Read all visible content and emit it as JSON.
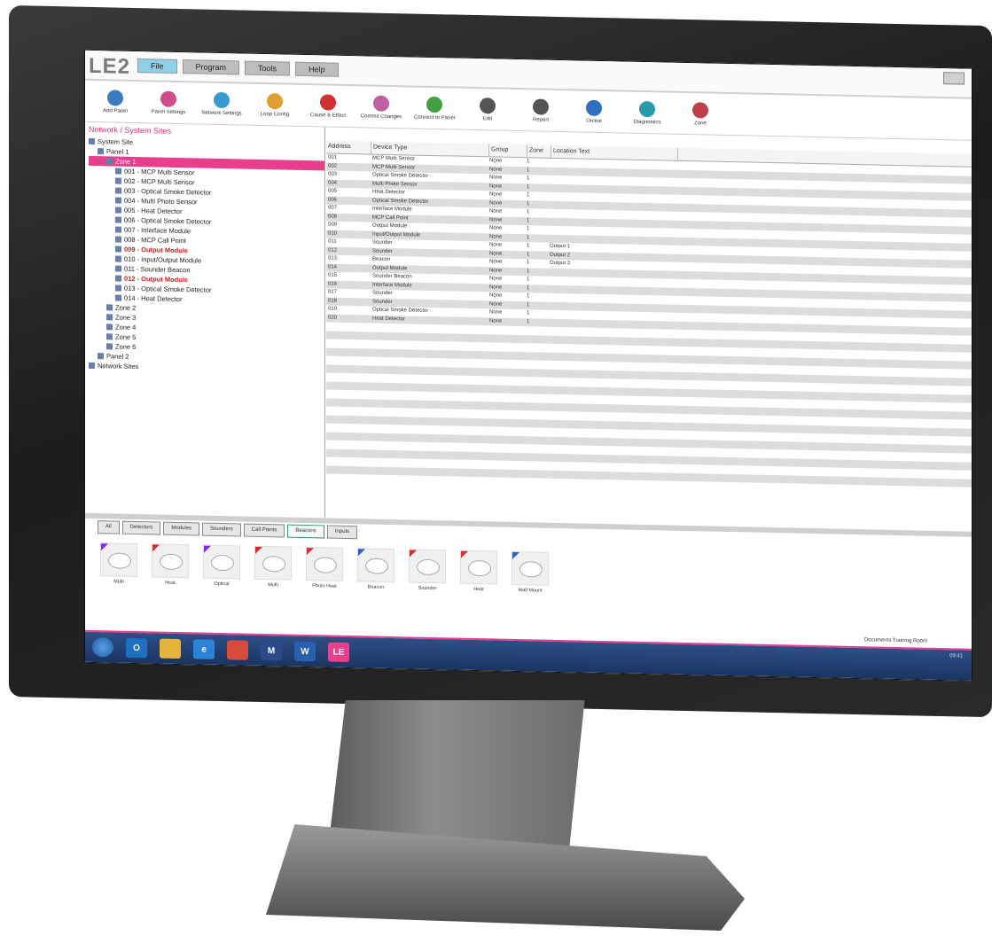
{
  "app": {
    "logo": "LE2"
  },
  "menu_tabs": [
    {
      "label": "File",
      "active": true
    },
    {
      "label": "Program",
      "active": false
    },
    {
      "label": "Tools",
      "active": false
    },
    {
      "label": "Help",
      "active": false
    }
  ],
  "ribbon": [
    {
      "label": "Add Panel",
      "icon": "panel-icon",
      "color": "#3a7bbf"
    },
    {
      "label": "Panel Settings",
      "icon": "gear-icon",
      "color": "#d04c8c"
    },
    {
      "label": "Network Settings",
      "icon": "network-icon",
      "color": "#3a9ad0"
    },
    {
      "label": "Loop Config",
      "icon": "loop-icon",
      "color": "#e0a030"
    },
    {
      "label": "Cause & Effect",
      "icon": "warning-icon",
      "color": "#d03030"
    },
    {
      "label": "Commit Changes",
      "icon": "commit-icon",
      "color": "#c060a0"
    },
    {
      "label": "Connect to Panel",
      "icon": "connect-icon",
      "color": "#40a040"
    },
    {
      "label": "Edit",
      "icon": "edit-icon",
      "color": "#555555"
    },
    {
      "label": "Report",
      "icon": "report-icon",
      "color": "#555555"
    },
    {
      "label": "Online",
      "icon": "online-icon",
      "color": "#3070c0"
    },
    {
      "label": "Diagnostics",
      "icon": "diagnostics-icon",
      "color": "#2a9aaa"
    },
    {
      "label": "Zone",
      "icon": "zone-icon",
      "color": "#c0404a"
    }
  ],
  "left_panel": {
    "title": "Network / System Sites",
    "tree": [
      {
        "label": "System Site",
        "indent": 0,
        "style": ""
      },
      {
        "label": "Panel 1",
        "indent": 1,
        "style": ""
      },
      {
        "label": "Zone 1",
        "indent": 2,
        "style": "sel"
      },
      {
        "label": "001 - MCP Multi Sensor",
        "indent": 3,
        "style": ""
      },
      {
        "label": "002 - MCP Multi Sensor",
        "indent": 3,
        "style": ""
      },
      {
        "label": "003 - Optical Smoke Detector",
        "indent": 3,
        "style": ""
      },
      {
        "label": "004 - Multi Photo Sensor",
        "indent": 3,
        "style": ""
      },
      {
        "label": "005 - Heat Detector",
        "indent": 3,
        "style": ""
      },
      {
        "label": "006 - Optical Smoke Detector",
        "indent": 3,
        "style": ""
      },
      {
        "label": "007 - Interface Module",
        "indent": 3,
        "style": ""
      },
      {
        "label": "008 - MCP Call Point",
        "indent": 3,
        "style": ""
      },
      {
        "label": "009 - Output Module",
        "indent": 3,
        "style": "red"
      },
      {
        "label": "010 - Input/Output Module",
        "indent": 3,
        "style": ""
      },
      {
        "label": "011 - Sounder Beacon",
        "indent": 3,
        "style": ""
      },
      {
        "label": "012 - Output Module",
        "indent": 3,
        "style": "red"
      },
      {
        "label": "013 - Optical Smoke Detector",
        "indent": 3,
        "style": ""
      },
      {
        "label": "014 - Heat Detector",
        "indent": 3,
        "style": ""
      },
      {
        "label": "Zone 2",
        "indent": 2,
        "style": ""
      },
      {
        "label": "Zone 3",
        "indent": 2,
        "style": ""
      },
      {
        "label": "Zone 4",
        "indent": 2,
        "style": ""
      },
      {
        "label": "Zone 5",
        "indent": 2,
        "style": ""
      },
      {
        "label": "Zone 6",
        "indent": 2,
        "style": ""
      },
      {
        "label": "Panel 2",
        "indent": 1,
        "style": ""
      },
      {
        "label": "Network Sites",
        "indent": 0,
        "style": ""
      }
    ]
  },
  "grid": {
    "columns": [
      "Address",
      "Device Type",
      "Group",
      "Zone",
      "Location Text"
    ],
    "rows": [
      [
        "001",
        "MCP Multi Sensor",
        "None",
        "1",
        ""
      ],
      [
        "002",
        "MCP Multi Sensor",
        "None",
        "1",
        ""
      ],
      [
        "003",
        "Optical Smoke Detector",
        "None",
        "1",
        ""
      ],
      [
        "004",
        "Multi Photo Sensor",
        "None",
        "1",
        ""
      ],
      [
        "005",
        "Heat Detector",
        "None",
        "1",
        ""
      ],
      [
        "006",
        "Optical Smoke Detector",
        "None",
        "1",
        ""
      ],
      [
        "007",
        "Interface Module",
        "None",
        "1",
        ""
      ],
      [
        "008",
        "MCP Call Point",
        "None",
        "1",
        ""
      ],
      [
        "009",
        "Output Module",
        "None",
        "1",
        ""
      ],
      [
        "010",
        "Input/Output Module",
        "None",
        "1",
        ""
      ],
      [
        "011",
        "Sounder",
        "None",
        "1",
        "Output 1"
      ],
      [
        "012",
        "Sounder",
        "None",
        "1",
        "Output 2"
      ],
      [
        "013",
        "Beacon",
        "None",
        "1",
        "Output 3"
      ],
      [
        "014",
        "Output Module",
        "None",
        "1",
        ""
      ],
      [
        "015",
        "Sounder Beacon",
        "None",
        "1",
        ""
      ],
      [
        "016",
        "Interface Module",
        "None",
        "1",
        ""
      ],
      [
        "017",
        "Sounder",
        "None",
        "1",
        ""
      ],
      [
        "018",
        "Sounder",
        "None",
        "1",
        ""
      ],
      [
        "019",
        "Optical Smoke Detector",
        "None",
        "1",
        ""
      ],
      [
        "020",
        "Heat Detector",
        "None",
        "1",
        ""
      ]
    ],
    "filler_rows": 18
  },
  "palette": {
    "tabs": [
      {
        "label": "All",
        "active": false
      },
      {
        "label": "Detectors",
        "active": false
      },
      {
        "label": "Modules",
        "active": false
      },
      {
        "label": "Sounders",
        "active": false
      },
      {
        "label": "Call Points",
        "active": false
      },
      {
        "label": "Beacons",
        "active": true
      },
      {
        "label": "Inputs",
        "active": false
      }
    ],
    "devices": [
      {
        "label": "Multi",
        "corner": "#8a2be2"
      },
      {
        "label": "Heat",
        "corner": "#d03030"
      },
      {
        "label": "Optical",
        "corner": "#8a2be2"
      },
      {
        "label": "Multi",
        "corner": "#d03030"
      },
      {
        "label": "Photo Heat",
        "corner": "#d03030"
      },
      {
        "label": "Beacon",
        "corner": "#3060c0"
      },
      {
        "label": "Sounder",
        "corner": "#d03030"
      },
      {
        "label": "Heat",
        "corner": "#d03030"
      },
      {
        "label": "Wall Mount",
        "corner": "#3060c0"
      }
    ]
  },
  "statusbar": {
    "text": "Documents   Training Room"
  },
  "taskbar": {
    "icons": [
      {
        "name": "start-orb-icon",
        "text": "",
        "color": "#1e5ba8"
      },
      {
        "name": "outlook-icon",
        "text": "O",
        "color": "#1d6fc1"
      },
      {
        "name": "folder-icon",
        "text": "",
        "color": "#e6b43c"
      },
      {
        "name": "ie-icon",
        "text": "e",
        "color": "#2a84d8"
      },
      {
        "name": "chrome-icon",
        "text": "",
        "color": "#d84a3a"
      },
      {
        "name": "manual-icon",
        "text": "M",
        "color": "#2c4a8a"
      },
      {
        "name": "word-icon",
        "text": "W",
        "color": "#2b5fb0"
      },
      {
        "name": "le2-taskbar-icon",
        "text": "LE",
        "color": "#e83e8c"
      }
    ],
    "clock": "09:41"
  }
}
